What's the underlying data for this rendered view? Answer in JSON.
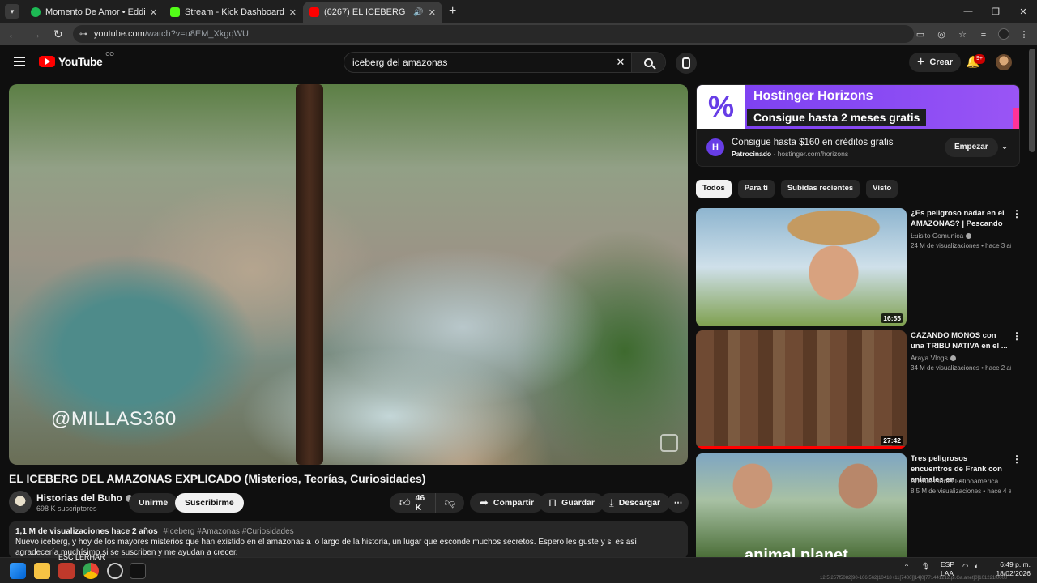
{
  "browser": {
    "tabs": [
      {
        "title": "Momento De Amor • Eddie Sant",
        "favicon_color": "#1db954",
        "active": false
      },
      {
        "title": "Stream - Kick Dashboard",
        "favicon_color": "#53fc18",
        "active": false
      },
      {
        "title": "(6267) EL ICEBERG DEL AMAZ",
        "favicon_color": "#ff0000",
        "active": true
      }
    ],
    "url_host": "youtube.com",
    "url_path": "/watch?v=u8EM_XkgqWU"
  },
  "yt_header": {
    "logo_text": "YouTube",
    "country_code": "CO",
    "search_query": "iceberg del amazonas",
    "create_label": "Crear",
    "notification_badge": "9+"
  },
  "video": {
    "watermark": "@MILLAS360",
    "title": "EL ICEBERG DEL AMAZONAS EXPLICADO (Misterios, Teorías, Curiosidades)",
    "channel_name": "Historias del Buho",
    "subscribers": "698 K suscriptores",
    "join_label": "Unirme",
    "subscribe_label": "Suscribirme",
    "likes": "46 K",
    "share_label": "Compartir",
    "save_label": "Guardar",
    "download_label": "Descargar",
    "views_date": "1,1 M de visualizaciones  hace 2 años",
    "hashtags": "#Iceberg #Amazonas #Curiosidades",
    "description": "Nuevo iceberg, y hoy de los mayores misterios que han existido en el amazonas a lo largo de la historia, un lugar que esconde muchos secretos. Espero les guste y si es así, agradecería muchísimo si se suscriben y me ayudan a crecer."
  },
  "ad": {
    "banner_brand": "Hostinger Horizons",
    "banner_offer": "Consigue hasta 2 meses gratis",
    "title": "Consigue hasta $160 en créditos gratis",
    "sponsored_label": "Patrocinado",
    "domain": "hostinger.com/horizons",
    "cta": "Empezar"
  },
  "chips": [
    "Todos",
    "Para ti",
    "Subidas recientes",
    "Visto"
  ],
  "recommendations": [
    {
      "title": "¿Es peligroso nadar en el AMAZONAS? | Pescando ...",
      "channel": "Luisito Comunica",
      "meta": "24 M de visualizaciones • hace 3 añ...",
      "duration": "16:55",
      "watched_fraction": 0
    },
    {
      "title": "CAZANDO MONOS con una TRIBU NATIVA en el ...",
      "channel": "Araya Vlogs",
      "meta": "34 M de visualizaciones • hace 2 añ...",
      "duration": "27:42",
      "watched_fraction": 1.0
    },
    {
      "title": "Tres peligrosos encuentros de Frank con animales en ...",
      "channel": "Animal Planet Latinoamérica",
      "meta": "8,5 M de visualizaciones • hace 4 añ...",
      "duration": "",
      "watched_fraction": 0,
      "thumb_text": "animal planet"
    }
  ],
  "taskbar": {
    "tooltip": "ESC LERHAR",
    "lang_line1": "ESP",
    "lang_line2": "LAA",
    "time": "6:49 p. m.",
    "date": "18/02/2026",
    "build_text": "12.5.257f5082[90-106.562]10418+11[7400]]14]0]771441212.pl.Ga.anet]0]101221f0000"
  }
}
